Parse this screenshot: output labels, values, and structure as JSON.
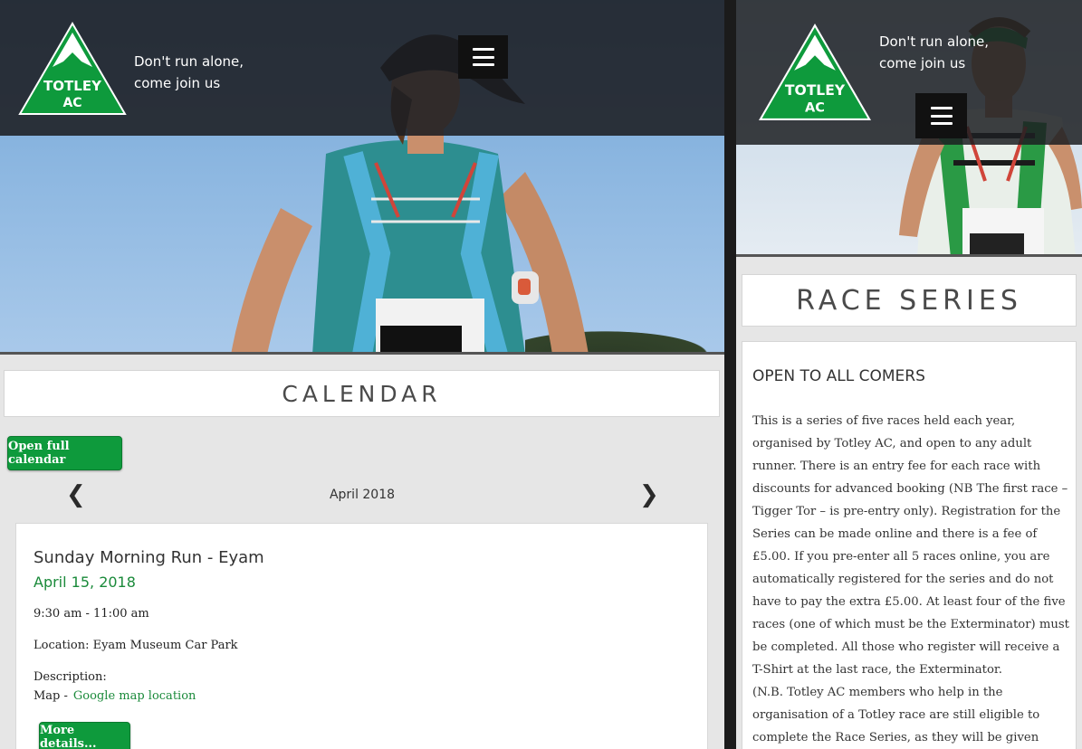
{
  "left": {
    "logo": {
      "text_line1": "TOTLEY",
      "text_line2": "AC"
    },
    "tagline": {
      "line1": "Don't run alone,",
      "line2": "come join us"
    },
    "page_title": "CALENDAR",
    "open_calendar_label": "Open full calendar",
    "calendar_nav": {
      "month": "April 2018",
      "prev_icon": "chevron-left-icon",
      "next_icon": "chevron-right-icon"
    },
    "event": {
      "title": "Sunday Morning Run - Eyam",
      "date": "April 15, 2018",
      "time": "9:30 am - 11:00 am",
      "location": "Location: Eyam Museum Car Park",
      "description_label": "Description:",
      "map_label": "Map -",
      "map_link": "Google map location",
      "details_label": "More details..."
    }
  },
  "right": {
    "logo": {
      "text_line1": "TOTLEY",
      "text_line2": "AC"
    },
    "tagline": {
      "line1": "Don't run alone,",
      "line2": "come join us"
    },
    "page_title": "RACE SERIES",
    "article": {
      "heading": "OPEN TO ALL COMERS",
      "body": "This is a series of five races held each year, organised by Totley AC, and open to any adult runner. There is an entry fee for each race with discounts for advanced booking (NB The first race – Tigger Tor – is pre-entry only). Registration for the Series can be made online and there is a fee of £5.00. If you pre-enter all 5 races online, you are automatically registered for the series and do not have to pay the extra £5.00. At least four of the five races (one of which must be the Exterminator) must be completed. All those who register will receive a T-Shirt at the last race, the Exterminator.",
      "note": "(N.B. Totley AC members who help in the organisation of a Totley race are still eligible to complete the Race Series, as they will be given their average position for the race they miss.)"
    }
  },
  "colors": {
    "brand_green": "#0e9a3c",
    "link_green": "#1a8a3a",
    "header_dark": "#1c1e22"
  }
}
